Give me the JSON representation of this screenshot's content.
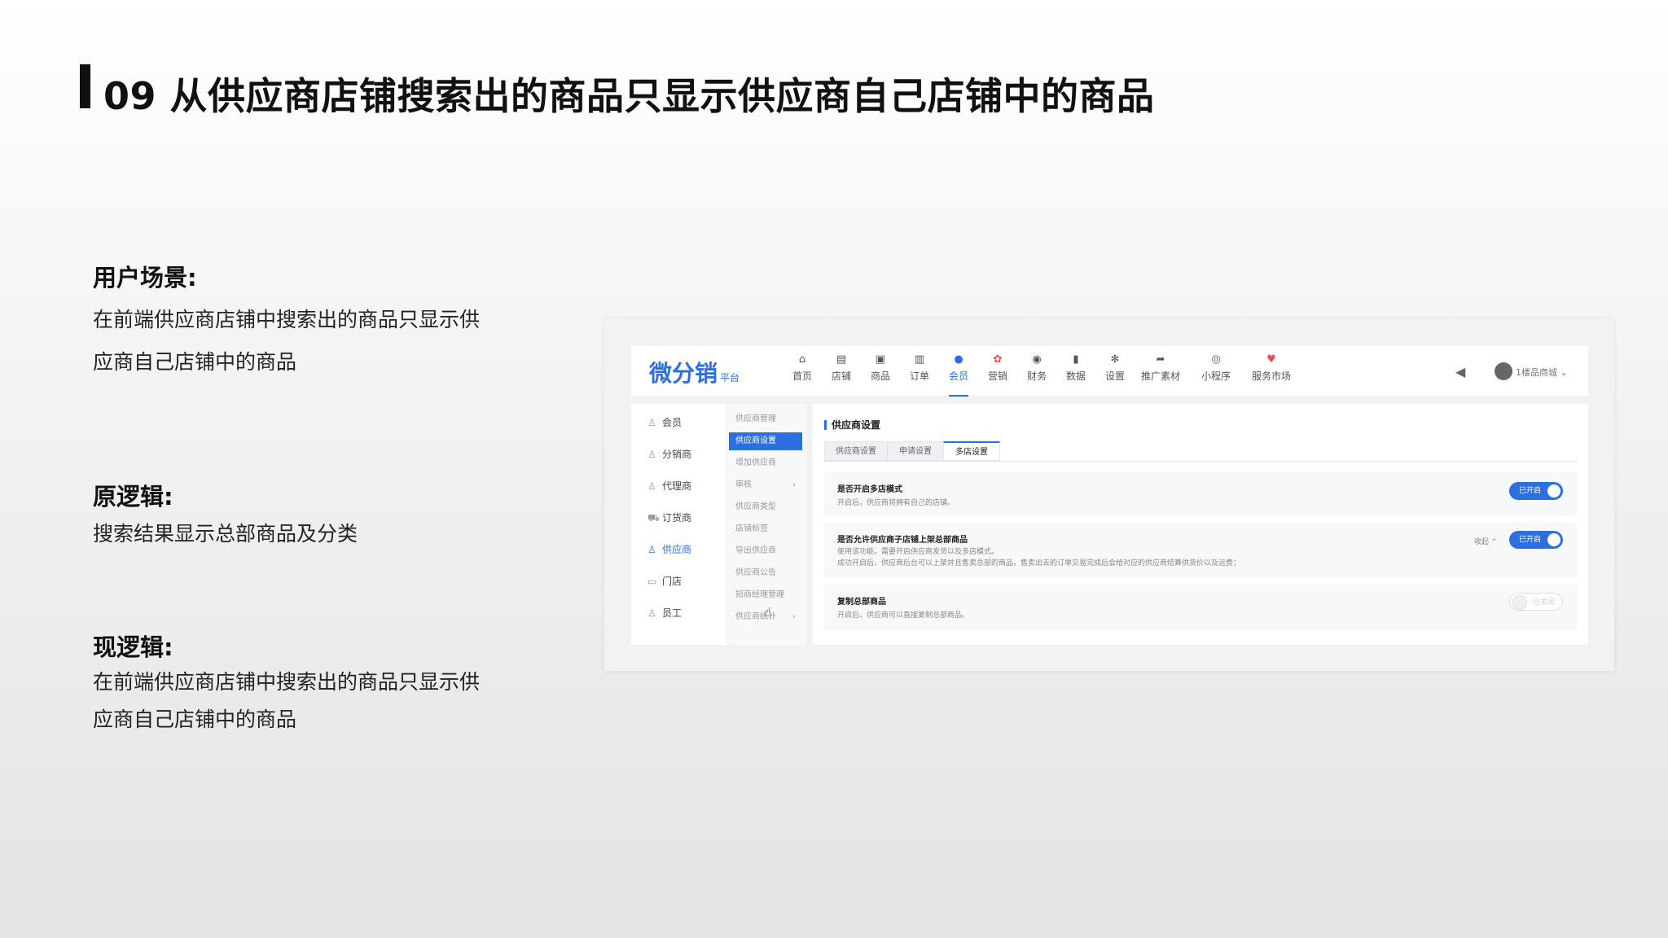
{
  "slide": {
    "title": "09 从供应商店铺搜索出的商品只显示供应商自己店铺中的商品",
    "sections": [
      {
        "heading": "用户场景:",
        "lines": [
          "在前端供应商店铺中搜索出的商品只显示供",
          "应商自己店铺中的商品"
        ]
      },
      {
        "heading": "原逻辑:",
        "lines": [
          "搜索结果显示总部商品及分类"
        ]
      },
      {
        "heading": "现逻辑:",
        "lines": [
          "在前端供应商店铺中搜索出的商品只显示供",
          "应商自己店铺中的商品"
        ]
      }
    ]
  },
  "app": {
    "logo": "微分销",
    "logo_sub": "平台",
    "nav": [
      {
        "label": "首页",
        "icon": "home-icon"
      },
      {
        "label": "店铺",
        "icon": "store-icon"
      },
      {
        "label": "商品",
        "icon": "goods-icon"
      },
      {
        "label": "订单",
        "icon": "order-icon"
      },
      {
        "label": "会员",
        "icon": "member-icon",
        "active": true
      },
      {
        "label": "营销",
        "icon": "marketing-icon"
      },
      {
        "label": "财务",
        "icon": "finance-icon"
      },
      {
        "label": "数据",
        "icon": "chart-icon"
      },
      {
        "label": "设置",
        "icon": "gear-icon"
      },
      {
        "label": "推广素材",
        "icon": "share-icon"
      },
      {
        "label": "小程序",
        "icon": "miniapp-icon"
      },
      {
        "label": "服务市场",
        "icon": "market-icon"
      }
    ],
    "store_name": "1楼品商城",
    "sidebar": [
      "会员",
      "分销商",
      "代理商",
      "订货商",
      "供应商",
      "门店",
      "员工"
    ],
    "sidebar_active": "供应商",
    "submenu": [
      "供应商管理",
      "供应商设置",
      "增加供应商",
      "审核",
      "供应商类型",
      "店铺标签",
      "导出供应商",
      "供应商公告",
      "招商经理管理",
      "供应商统计"
    ],
    "submenu_active": "供应商设置",
    "content_title": "供应商设置",
    "tabs": [
      "供应商设置",
      "申请设置",
      "多店设置"
    ],
    "active_tab": "多店设置",
    "settings": [
      {
        "title": "是否开启多店模式",
        "desc": [
          "开启后，供应商将拥有自己的店铺。"
        ],
        "toggle": "已开启",
        "on": true
      },
      {
        "title": "是否允许供应商子店铺上架总部商品",
        "desc": [
          "使用该功能，需要开启供应商发货以及多店模式。",
          "成功开启后，供应商后台可以上架并且售卖总部的商品，售卖出去的订单交易完成后会给对应的供应商结算供货价以及运费；"
        ],
        "toggle": "已开启",
        "on": true,
        "collapse": "收起 ^"
      },
      {
        "title": "复制总部商品",
        "desc": [
          "开启后，供应商可以直接复制总部商品。"
        ],
        "toggle": "已关闭",
        "on": false
      }
    ],
    "colors": {
      "accent": "#2c6fe0"
    }
  }
}
